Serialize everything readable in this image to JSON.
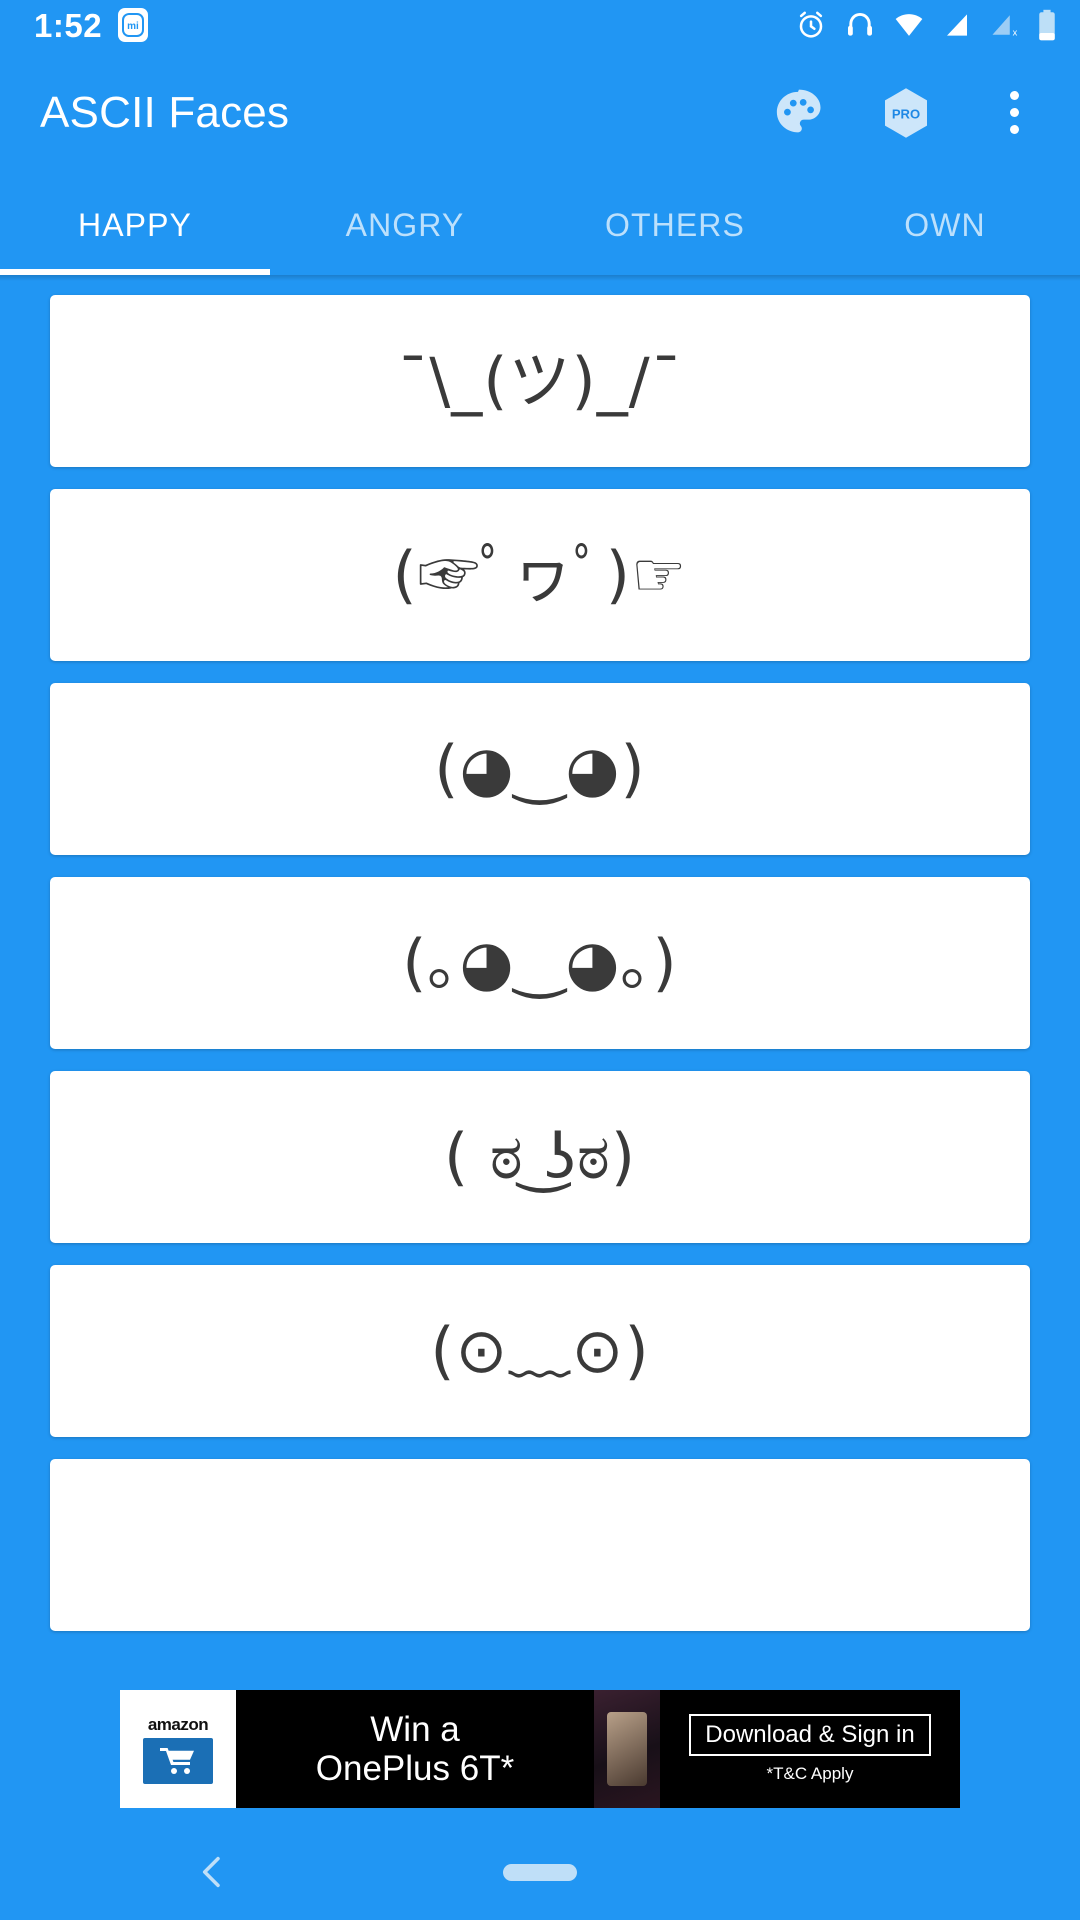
{
  "theme": {
    "primary": "#2196f3",
    "card_bg": "#ffffff",
    "face_color": "#3a3a3a",
    "accent_text": "#ffffff"
  },
  "statusbar": {
    "time": "1:52",
    "app_badge": "mi",
    "icons": [
      "alarm-icon",
      "headset-icon",
      "wifi-icon",
      "signal-icon",
      "signal-off-icon",
      "battery-icon"
    ]
  },
  "appbar": {
    "title": "ASCII Faces",
    "actions": [
      {
        "name": "palette-icon",
        "label": ""
      },
      {
        "name": "pro-badge-icon",
        "label": "PRO"
      },
      {
        "name": "overflow-menu-icon",
        "label": ""
      }
    ]
  },
  "tabs": {
    "items": [
      {
        "label": "HAPPY",
        "active": true
      },
      {
        "label": "ANGRY",
        "active": false
      },
      {
        "label": "OTHERS",
        "active": false
      },
      {
        "label": "OWN",
        "active": false
      }
    ],
    "selected_index": 0
  },
  "faces": [
    {
      "text": "¯\\_(ツ)_/¯"
    },
    {
      "text": "(☞ﾟヮﾟ)☞"
    },
    {
      "text": "(◕‿◕)"
    },
    {
      "text": "(｡◕‿◕｡)"
    },
    {
      "text": "( ಠ ͜ʖಠ)"
    },
    {
      "text": "(⊙﹏⊙)"
    },
    {
      "text": ""
    }
  ],
  "ad": {
    "brand": "amazon",
    "headline_line1": "Win a",
    "headline_line2": "OnePlus 6T*",
    "cta": "Download & Sign in",
    "disclaimer": "*T&C Apply"
  },
  "navbar": {
    "back_label": "back-button",
    "home_label": "home-pill"
  }
}
